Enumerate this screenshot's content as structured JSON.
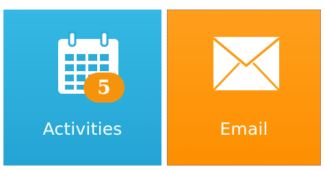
{
  "tiles": {
    "activities": {
      "label": "Activities",
      "badge_count": "5",
      "icon": "calendar-icon",
      "color": "#2aabd9",
      "badge_color": "#f5940c"
    },
    "email": {
      "label": "Email",
      "icon": "envelope-icon",
      "color": "#fd9a10"
    }
  }
}
